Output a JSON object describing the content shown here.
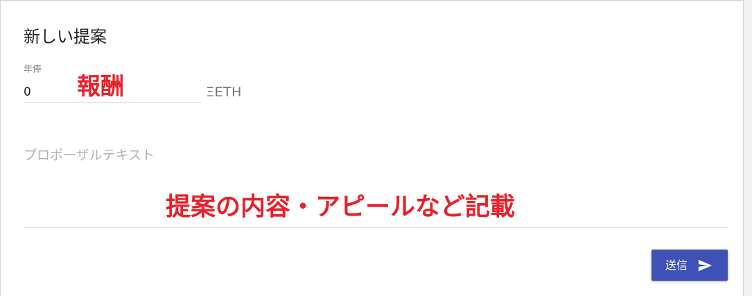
{
  "form": {
    "title": "新しい提案",
    "salary": {
      "label": "年俸",
      "value": "0",
      "unit": "ΞETH"
    },
    "proposal_text": {
      "placeholder": "プロポーザルテキスト",
      "value": ""
    },
    "submit": {
      "label": "送信",
      "icon": "send-icon"
    }
  },
  "annotations": {
    "reward": "報酬",
    "content": "提案の内容・アピールなど記載",
    "color": "#e8202a"
  },
  "colors": {
    "button": "#3f51b5",
    "annotation": "#e8202a"
  }
}
